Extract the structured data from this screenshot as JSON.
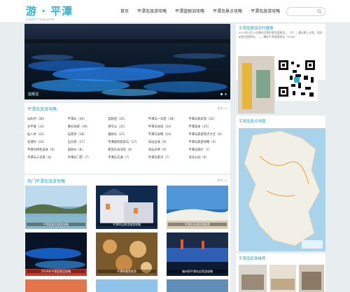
{
  "header": {
    "logo_text": "游 · 平潭",
    "logo_sub": "pingtan travel guide",
    "nav": [
      "首页",
      "平潭岛旅游攻略",
      "平潭蓝眼泪攻略",
      "平潭岛景点攻略",
      "平潭岛旅游攻略"
    ],
    "search_icon": "search-icon"
  },
  "slider": {
    "caption": "蓝眼泪"
  },
  "guide": {
    "title": "平潭岛旅游攻略",
    "more": "更多>>",
    "rows": [
      [
        "岛屿村（36）",
        "平潭岛（40）",
        "蓝眼泪（25）",
        "平潭岛一日游（38）",
        "平潭岛两日游（22）"
      ],
      [
        "长平嵬（33）",
        "象屿海峡（39）",
        "将军山（35）",
        "平潭岛住宿（24）",
        "平潭美食（25）"
      ],
      [
        "仙人井（22）",
        "坛南湾（18）",
        "猴研岛（21）",
        "平潭岛攻略（19）",
        "平潭岛旅游景点大全（9）"
      ],
      [
        "北港村（22）",
        "石头厝（17）",
        "平潭国际旅游岛（17）",
        "海坛古城（9）",
        "平潭岛旅游攻略（4）"
      ],
      [
        "平潭岛特色美食（9）",
        "国防州（8）",
        "麦凯乐海洋馆（9）",
        "海坛天神（9）",
        "平潭岛图片（7）"
      ],
      [
        "平潭岛三日游（8）",
        "平潭岛门票（7）",
        "平潭岛交通（7）",
        "平潭岛景点（7）",
        "海洋公园（6）"
      ]
    ]
  },
  "hot": {
    "title": "热门平潭岛旅游攻略",
    "more": "更多>>",
    "items": [
      "平潭蓝眼泪观赏攻略",
      "平潭岛坛南湾旅游攻略",
      "平潭石头厝民宿推荐",
      "2019年平潭蓝眼泪攻略",
      "平潭岛美食推荐",
      "福州到平潭岛自驾游攻略"
    ]
  },
  "qr": {
    "title": "平潭蓝眼泪实时播报",
    "text": "2019年4月15日晚在北港村看到蓝眼泪，（大），建议晚上出发，找好拍照位置等待。—— 最新平潭游客报告（9198）"
  },
  "map": {
    "title": "平潭岛景点地图"
  },
  "hotel": {
    "title": "平潭岛民宿推荐"
  },
  "colors": {
    "accent": "#2ba3b7",
    "background": "#e8eef0"
  }
}
